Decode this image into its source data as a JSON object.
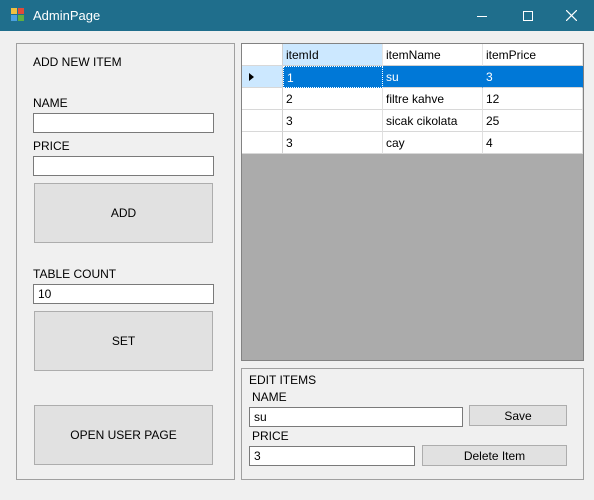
{
  "window": {
    "title": "AdminPage"
  },
  "add_item": {
    "header": "ADD NEW ITEM",
    "name_label": "NAME",
    "name_value": "",
    "price_label": "PRICE",
    "price_value": "",
    "add_button": "ADD"
  },
  "table_count": {
    "label": "TABLE COUNT",
    "value": "10",
    "set_button": "SET"
  },
  "open_user_page_button": "OPEN USER PAGE",
  "grid": {
    "columns": [
      "itemId",
      "itemName",
      "itemPrice"
    ],
    "rows": [
      [
        "1",
        "su",
        "3"
      ],
      [
        "2",
        "filtre kahve",
        "12"
      ],
      [
        "3",
        "sicak cikolata",
        "25"
      ],
      [
        "3",
        "cay",
        "4"
      ]
    ],
    "selected_row": 0
  },
  "edit_items": {
    "header": "EDIT ITEMS",
    "name_label": "NAME",
    "name_value": "su",
    "price_label": "PRICE",
    "price_value": "3",
    "save_button": "Save",
    "delete_button": "Delete Item"
  },
  "colors": {
    "titlebar": "#1f6e8c",
    "selection": "#0078d7",
    "grid_background": "#ababab"
  }
}
